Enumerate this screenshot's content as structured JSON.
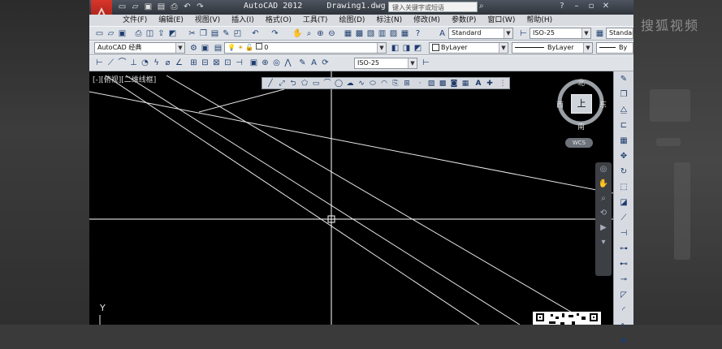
{
  "window": {
    "title": "AutoCAD 2012     Drawing1.dwg",
    "search_placeholder": "键入关键字或短语"
  },
  "watermark": "搜狐视频",
  "menu": [
    "文件(F)",
    "编辑(E)",
    "视图(V)",
    "插入(I)",
    "格式(O)",
    "工具(T)",
    "绘图(D)",
    "标注(N)",
    "修改(M)",
    "参数(P)",
    "窗口(W)",
    "帮助(H)"
  ],
  "toolbar": {
    "text_style": "Standard",
    "dim_style": "ISO-25",
    "table_style": "Standard",
    "workspace": "AutoCAD 经典",
    "layer": "0",
    "color": "ByLayer",
    "linetype": "ByLayer",
    "lineweight": "By",
    "dim_style_2": "ISO-25"
  },
  "viewport": {
    "label": "[-][俯视][二维线框]"
  },
  "viewcube": {
    "north": "北",
    "south": "南",
    "east": "东",
    "west": "西",
    "face": "上",
    "wcs": "WCS"
  },
  "ucs": {
    "y_label": "Y"
  },
  "colors": {
    "canvas": "#000000",
    "geometry": "#e8e8e8",
    "crosshair": "#ffffff",
    "toolbar": "#dfe3e8",
    "logo": "#c62a20"
  },
  "icons": {
    "quick_access": [
      "new-icon",
      "open-icon",
      "save-icon",
      "saveas-icon",
      "print-icon",
      "undo-icon",
      "redo-icon"
    ],
    "float_draw": [
      "line-icon",
      "construction-line-icon",
      "polyline-icon",
      "polygon-icon",
      "rectangle-icon",
      "arc-icon",
      "circle-icon",
      "revcloud-icon",
      "spline-icon",
      "ellipse-icon",
      "ellipse-arc-icon",
      "insert-block-icon",
      "make-block-icon",
      "point-icon",
      "hatch-icon",
      "gradient-icon",
      "region-icon",
      "table-icon",
      "mtext-icon",
      "add-selected-icon"
    ]
  }
}
